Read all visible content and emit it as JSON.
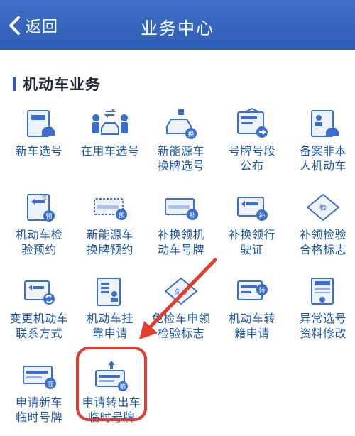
{
  "header": {
    "back_label": "返回",
    "title": "业务中心"
  },
  "section": {
    "title": "机动车业务"
  },
  "items": [
    {
      "label_line1": "新车选号",
      "label_line2": ""
    },
    {
      "label_line1": "在用车选号",
      "label_line2": ""
    },
    {
      "label_line1": "新能源车",
      "label_line2": "换牌选号"
    },
    {
      "label_line1": "号牌号段",
      "label_line2": "公布"
    },
    {
      "label_line1": "备案非本",
      "label_line2": "人机动车"
    },
    {
      "label_line1": "机动车检",
      "label_line2": "验预约"
    },
    {
      "label_line1": "新能源车",
      "label_line2": "换牌预约"
    },
    {
      "label_line1": "补换领机",
      "label_line2": "动车号牌"
    },
    {
      "label_line1": "补换领行",
      "label_line2": "驶证"
    },
    {
      "label_line1": "补领检验",
      "label_line2": "合格标志"
    },
    {
      "label_line1": "变更机动车",
      "label_line2": "联系方式"
    },
    {
      "label_line1": "机动车挂",
      "label_line2": "靠申请"
    },
    {
      "label_line1": "免检车申领",
      "label_line2": "检验标志"
    },
    {
      "label_line1": "机动车转",
      "label_line2": "籍申请"
    },
    {
      "label_line1": "异常选号",
      "label_line2": "资料修改"
    },
    {
      "label_line1": "申请新车",
      "label_line2": "临时号牌"
    },
    {
      "label_line1": "申请转出车",
      "label_line2": "临时号牌"
    }
  ],
  "icon_badges": {
    "swap": "换",
    "check": "检",
    "reserve": "预",
    "reissue": "补",
    "transfer": "转",
    "temp": "临",
    "exempt": "免检"
  },
  "colors": {
    "header": "#2f5db5",
    "label": "#1c56a8",
    "icon_blue": "#3a6fd0",
    "highlight": "#e23b2f"
  }
}
